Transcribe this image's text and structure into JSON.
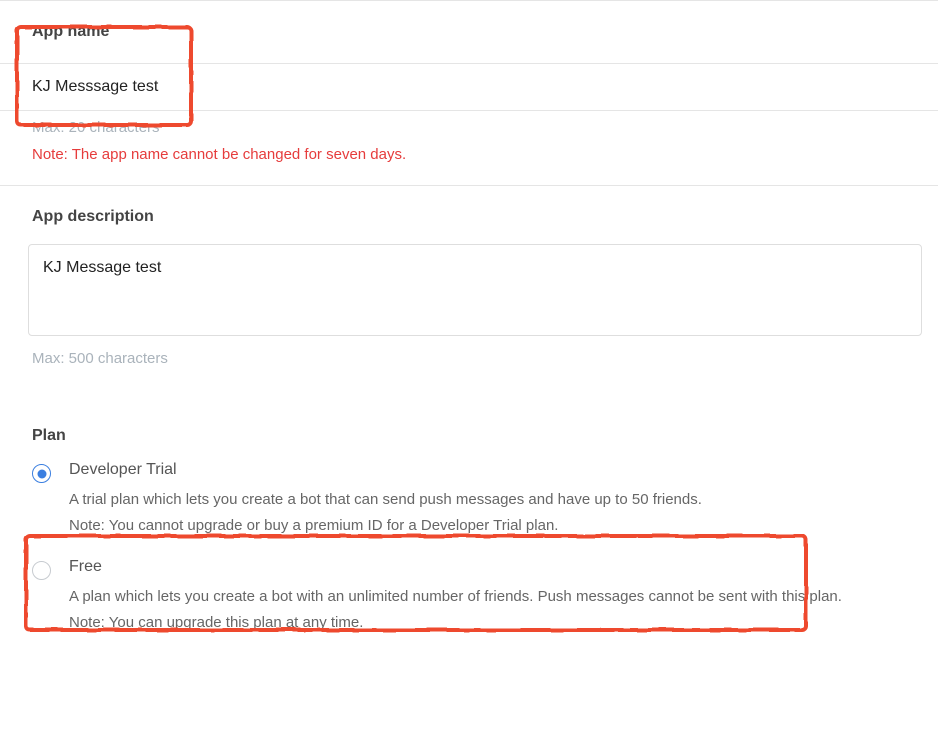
{
  "appName": {
    "label": "App name",
    "value": "KJ Messsage test",
    "maxHelper": "Max: 20 characters",
    "note": "Note: The app name cannot be changed for seven days."
  },
  "appDescription": {
    "label": "App description",
    "value": "KJ Message test",
    "maxHelper": "Max: 500 characters"
  },
  "plan": {
    "label": "Plan",
    "options": [
      {
        "title": "Developer Trial",
        "desc": "A trial plan which lets you create a bot that can send push messages and have up to 50 friends.",
        "note": "Note: You cannot upgrade or buy a premium ID for a Developer Trial plan.",
        "selected": true
      },
      {
        "title": "Free",
        "desc": "A plan which lets you create a bot with an unlimited number of friends. Push messages cannot be sent with this plan.",
        "note": "Note: You can upgrade this plan at any time.",
        "selected": false
      }
    ]
  }
}
